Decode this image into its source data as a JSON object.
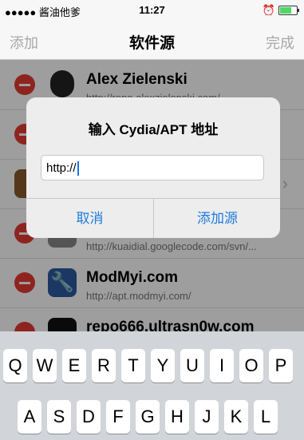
{
  "status": {
    "carrier": "●●●●● 酱油他爹",
    "time": "11:27"
  },
  "navbar": {
    "left": "添加",
    "title": "软件源",
    "right": "完成"
  },
  "sources": [
    {
      "title": "Alex Zielenski",
      "url": "http://repo.alexzielenski.com/"
    },
    {
      "title": "",
      "url": ""
    },
    {
      "title": "",
      "url": ""
    },
    {
      "title": "",
      "url": "http://kuaidial.googlecode.com/svn/..."
    },
    {
      "title": "ModMyi.com",
      "url": "http://apt.modmyi.com/"
    },
    {
      "title": "repo666.ultrasn0w.com",
      "url": ""
    }
  ],
  "dialog": {
    "title": "输入 Cydia/APT 地址",
    "input_value": "http://",
    "cancel": "取消",
    "add": "添加源"
  },
  "keyboard": {
    "row1": [
      "Q",
      "W",
      "E",
      "R",
      "T",
      "Y",
      "U",
      "I",
      "O",
      "P"
    ],
    "row2": [
      "A",
      "S",
      "D",
      "F",
      "G",
      "H",
      "J",
      "K",
      "L"
    ]
  },
  "colors": {
    "accent": "#1e7be0",
    "delete": "#e63a32"
  }
}
